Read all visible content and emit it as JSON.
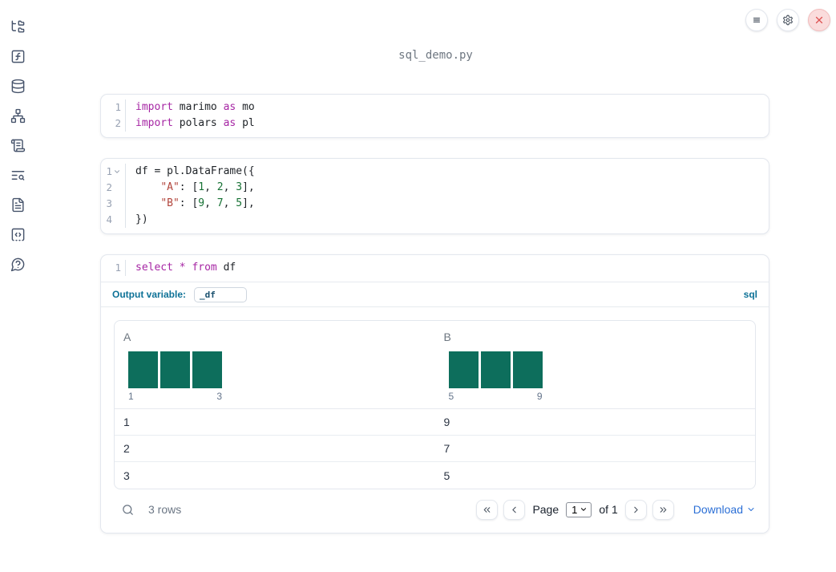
{
  "window": {
    "filename": "sql_demo.py"
  },
  "topbar": {
    "icons": [
      "menu-icon",
      "gear-icon",
      "close-icon"
    ]
  },
  "sidebar": {
    "icons": [
      "file-tree",
      "function-square",
      "database",
      "network",
      "scroll-text",
      "list-search",
      "file-text",
      "code-snippet",
      "help-chat"
    ]
  },
  "colors": {
    "keyword": "#a626a4",
    "string": "#b2453c",
    "number": "#177235",
    "histogram_bar": "#0d6e5c",
    "teal_label": "#0e7297",
    "link_blue": "#2b6fd6",
    "close_red": "#dd5454"
  },
  "cells": [
    {
      "type": "python",
      "lines": [
        {
          "n": "1",
          "tokens": [
            {
              "c": "kw",
              "t": "import"
            },
            {
              "c": "tx",
              "t": " marimo "
            },
            {
              "c": "kw",
              "t": "as"
            },
            {
              "c": "tx",
              "t": " mo"
            }
          ]
        },
        {
          "n": "2",
          "tokens": [
            {
              "c": "kw",
              "t": "import"
            },
            {
              "c": "tx",
              "t": " polars "
            },
            {
              "c": "kw",
              "t": "as"
            },
            {
              "c": "tx",
              "t": " pl"
            }
          ]
        }
      ]
    },
    {
      "type": "python",
      "lines": [
        {
          "n": "1",
          "fold": true,
          "tokens": [
            {
              "c": "tx",
              "t": "df = pl.DataFrame({"
            }
          ]
        },
        {
          "n": "2",
          "tokens": [
            {
              "c": "tx",
              "t": "    "
            },
            {
              "c": "str",
              "t": "\"A\""
            },
            {
              "c": "tx",
              "t": ": ["
            },
            {
              "c": "num",
              "t": "1"
            },
            {
              "c": "tx",
              "t": ", "
            },
            {
              "c": "num",
              "t": "2"
            },
            {
              "c": "tx",
              "t": ", "
            },
            {
              "c": "num",
              "t": "3"
            },
            {
              "c": "tx",
              "t": "],"
            }
          ]
        },
        {
          "n": "3",
          "tokens": [
            {
              "c": "tx",
              "t": "    "
            },
            {
              "c": "str",
              "t": "\"B\""
            },
            {
              "c": "tx",
              "t": ": ["
            },
            {
              "c": "num",
              "t": "9"
            },
            {
              "c": "tx",
              "t": ", "
            },
            {
              "c": "num",
              "t": "7"
            },
            {
              "c": "tx",
              "t": ", "
            },
            {
              "c": "num",
              "t": "5"
            },
            {
              "c": "tx",
              "t": "],"
            }
          ]
        },
        {
          "n": "4",
          "tokens": [
            {
              "c": "tx",
              "t": "})"
            }
          ]
        }
      ]
    },
    {
      "type": "sql",
      "lines": [
        {
          "n": "1",
          "tokens": [
            {
              "c": "kw",
              "t": "select"
            },
            {
              "c": "tx",
              "t": " "
            },
            {
              "c": "kw",
              "t": "*"
            },
            {
              "c": "tx",
              "t": " "
            },
            {
              "c": "kw",
              "t": "from"
            },
            {
              "c": "tx",
              "t": " df"
            }
          ]
        }
      ]
    }
  ],
  "sql_meta": {
    "output_variable_label": "Output variable:",
    "output_variable_value": "_df",
    "language_badge": "sql"
  },
  "table": {
    "columns": [
      {
        "name": "A",
        "histogram": {
          "bars": [
            1,
            1,
            1
          ],
          "min_label": "1",
          "max_label": "3"
        }
      },
      {
        "name": "B",
        "histogram": {
          "bars": [
            1,
            1,
            1
          ],
          "min_label": "5",
          "max_label": "9"
        }
      }
    ],
    "rows": [
      [
        "1",
        "9"
      ],
      [
        "2",
        "7"
      ],
      [
        "3",
        "5"
      ]
    ],
    "footer": {
      "row_count": "3 rows",
      "page_label": "Page",
      "page_value": "1",
      "of_label": "of 1",
      "download_label": "Download"
    }
  }
}
